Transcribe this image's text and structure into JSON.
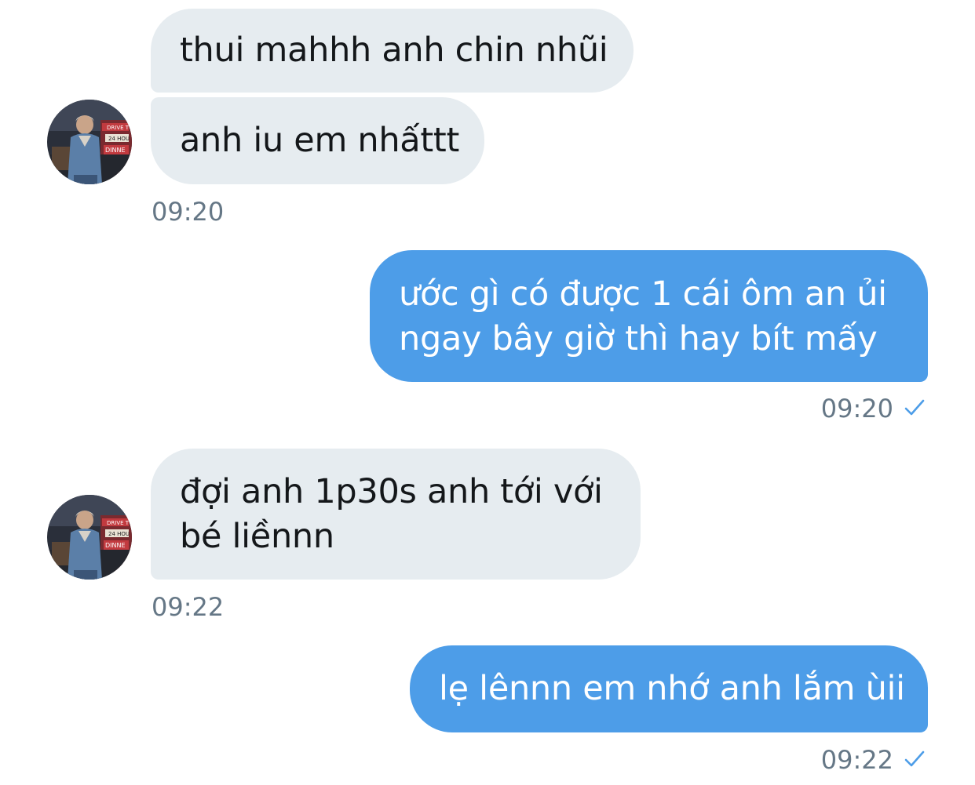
{
  "conversation": {
    "messages": [
      {
        "direction": "incoming",
        "lines": [
          "thui mahhh anh chin nhũi"
        ]
      },
      {
        "direction": "incoming",
        "lines": [
          "anh iu em nhấttt"
        ],
        "time": "09:20"
      },
      {
        "direction": "outgoing",
        "lines": [
          "ước gì có được 1 cái ôm an ủi",
          "ngay bây giờ thì hay bít mấy"
        ],
        "time": "09:20",
        "status_icon": "check-icon"
      },
      {
        "direction": "incoming",
        "lines": [
          "đợi anh 1p30s anh tới với",
          "bé liềnnn"
        ],
        "time": "09:22"
      },
      {
        "direction": "outgoing",
        "lines": [
          "lẹ lênnn em nhớ anh lắm ùii"
        ],
        "time": "09:22",
        "status_icon": "check-icon"
      }
    ],
    "avatar_sign_text": [
      "DRIVE T",
      "24 HOU",
      "DINNE"
    ]
  },
  "colors": {
    "incoming_bubble": "#e6ecf0",
    "outgoing_bubble": "#4d9de8",
    "timestamp": "#657786",
    "check": "#4d9de8"
  }
}
